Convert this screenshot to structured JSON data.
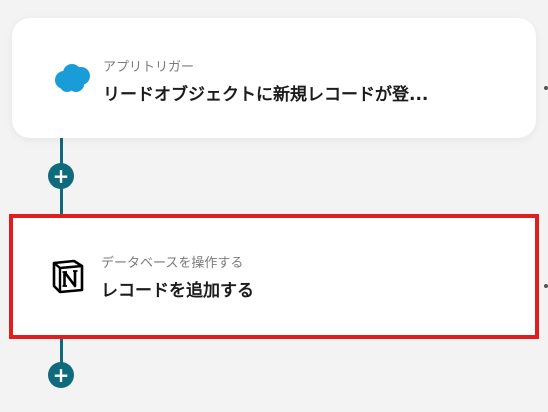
{
  "steps": [
    {
      "label": "アプリトリガー",
      "title": "リードオブジェクトに新規レコードが登...",
      "icon": "salesforce-cloud-icon",
      "color": "#1a9cd8"
    },
    {
      "label": "データベースを操作する",
      "title": "レコードを追加する",
      "icon": "notion-icon",
      "color": "#000000"
    }
  ],
  "add_button_label": "+",
  "colors": {
    "connector": "#0f6a7c",
    "highlight": "#e01e1e",
    "background": "#f3f3f3"
  }
}
